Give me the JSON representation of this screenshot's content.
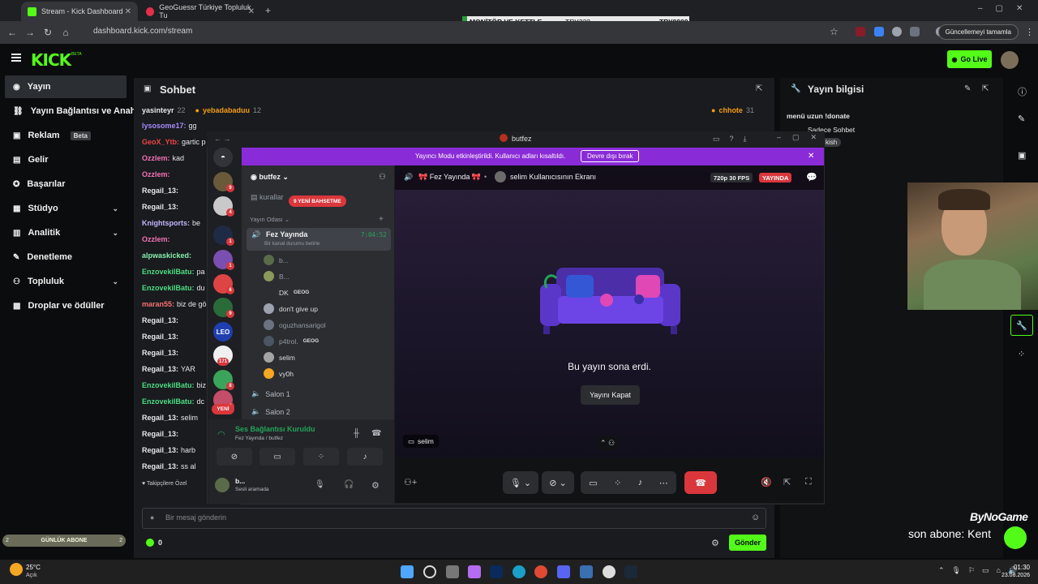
{
  "browser": {
    "tabs": [
      {
        "label": "Stream - Kick Dashboard",
        "active": true
      },
      {
        "label": "GeoGuessr Türkiye Topluluk Tu",
        "active": false
      }
    ],
    "new_tab": "+",
    "url": "dashboard.kick.com/stream",
    "update_label": "Güncellemeyi tamamla"
  },
  "ticker": {
    "item1": "MONİTÖR VE KETTLE",
    "item2": "TRY222",
    "item3": "TRY9999"
  },
  "kick": {
    "logo": "KICK",
    "logo_sup": "BETA",
    "go_live": "Go Live"
  },
  "sidebar": {
    "items": [
      {
        "label": "Yayın",
        "icon": "broadcast-icon"
      },
      {
        "label": "Yayın Bağlantısı ve Anahtarı",
        "icon": "link-icon"
      },
      {
        "label": "Reklam",
        "icon": "ad-icon",
        "badge": "Beta"
      },
      {
        "label": "Gelir",
        "icon": "revenue-icon"
      },
      {
        "label": "Başarılar",
        "icon": "trophy-icon"
      },
      {
        "label": "Stüdyo",
        "icon": "studio-icon"
      },
      {
        "label": "Analitik",
        "icon": "analytics-icon"
      },
      {
        "label": "Denetleme",
        "icon": "moderation-icon"
      },
      {
        "label": "Topluluk",
        "icon": "community-icon"
      },
      {
        "label": "Droplar ve ödüller",
        "icon": "drops-icon"
      }
    ],
    "sub_goal": "GÜNLÜK ABONE",
    "sub_left": "2",
    "sub_right": "2"
  },
  "chat": {
    "title": "Sohbet",
    "top_users": [
      {
        "name": "yasinteyr",
        "count": "22"
      },
      {
        "name": "yebadabaduu",
        "count": "12"
      },
      {
        "name": "chhote",
        "count": "31"
      }
    ],
    "lines": [
      {
        "user": "lysosome17:",
        "msg": "gg",
        "color": "#a78bfa"
      },
      {
        "user": "GeoX_Ytb:",
        "msg": "gartic p",
        "color": "#ef4444"
      },
      {
        "user": "Ozzlem:",
        "msg": "kad",
        "color": "#f472b6"
      },
      {
        "user": "Ozzlem:",
        "msg": "",
        "color": "#f472b6"
      },
      {
        "user": "Regail_13:",
        "msg": "",
        "color": "#e5e7eb"
      },
      {
        "user": "Regail_13:",
        "msg": "",
        "color": "#e5e7eb"
      },
      {
        "user": "Knightsports:",
        "msg": "be",
        "color": "#c4b5fd"
      },
      {
        "user": "Ozzlem:",
        "msg": "",
        "color": "#f472b6"
      },
      {
        "user": "alpwaskicked:",
        "msg": "",
        "color": "#86efac"
      },
      {
        "user": "EnzovekilBatu:",
        "msg": "pa",
        "color": "#4ade80"
      },
      {
        "user": "EnzovekilBatu:",
        "msg": "du",
        "color": "#4ade80"
      },
      {
        "user": "maran55:",
        "msg": "biz de gö",
        "color": "#f87171"
      },
      {
        "user": "Regail_13:",
        "msg": "",
        "color": "#e5e7eb"
      },
      {
        "user": "Regail_13:",
        "msg": "",
        "color": "#e5e7eb"
      },
      {
        "user": "Regail_13:",
        "msg": "",
        "color": "#e5e7eb"
      },
      {
        "user": "Regail_13:",
        "msg": "YAR",
        "color": "#e5e7eb"
      },
      {
        "user": "EnzovekilBatu:",
        "msg": "biz",
        "color": "#4ade80"
      },
      {
        "user": "EnzovekilBatu:",
        "msg": "dc",
        "color": "#4ade80"
      },
      {
        "user": "Regail_13:",
        "msg": "selim",
        "color": "#e5e7eb"
      },
      {
        "user": "Regail_13:",
        "msg": "",
        "color": "#e5e7eb"
      },
      {
        "user": "Regail_13:",
        "msg": "harb",
        "color": "#e5e7eb"
      },
      {
        "user": "Regail_13:",
        "msg": "ss al",
        "color": "#e5e7eb"
      }
    ],
    "followers_only": "Takipçilere Özel",
    "input_placeholder": "Bir mesaj gönderin",
    "points": "0",
    "send": "Gönder"
  },
  "discord": {
    "window_title": "butfez",
    "banner_text": "Yayıncı Modu etkinleştirildi. Kullanıcı adları kısaltıldı.",
    "banner_button": "Devre dışı bırak",
    "server_name": "butfez",
    "rules_channel": "kurallar",
    "new_mention": "9 YENİ BAHSETME",
    "category": "Yayın Odası",
    "voice_channel": "Fez Yayında",
    "voice_time": "7:04:52",
    "voice_status": "Bir kanal durumu belirle",
    "members": [
      {
        "name": "b...",
        "tag": ""
      },
      {
        "name": "B...",
        "tag": ""
      },
      {
        "name": "DK",
        "tag": "GEOG"
      },
      {
        "name": "don't give up",
        "tag": ""
      },
      {
        "name": "oguzhansarigol",
        "tag": ""
      },
      {
        "name": "p4trol.",
        "tag": "GEOG"
      },
      {
        "name": "selim",
        "tag": ""
      },
      {
        "name": "vy0h",
        "tag": ""
      }
    ],
    "salon1": "Salon 1",
    "salon2": "Salon 2",
    "new_badge": "YENİ",
    "server_badges": [
      "9",
      "4",
      "1",
      "1",
      "6",
      "9",
      "171",
      "8",
      "2"
    ],
    "leo": "LEO",
    "voice_connected": "Ses Bağlantısı Kuruldu",
    "voice_sub": "Fez Yayında",
    "voice_sub2": "/ butfez",
    "user_name": "b...",
    "user_status": "Sesli aramada",
    "stream_channel": "Fez Yayında",
    "stream_screen": "selim Kullanıcısının Ekranı",
    "quality": "720p 30 FPS",
    "live": "YAYINDA",
    "ended": "Bu yayın sona erdi.",
    "close_stream": "Yayını Kapat",
    "viewer_label": "selim"
  },
  "info": {
    "title": "Yayın bilgisi",
    "text1": "menü uzun !donate",
    "text2": "Sadece Sohbet",
    "tag": "kish"
  },
  "overlay": {
    "brand": "ByNoGame",
    "last_sub": "son abone: Kent"
  },
  "taskbar": {
    "temp": "25°C",
    "weather": "Açık",
    "time": "01:30",
    "date": "23.08.2026"
  },
  "colors": {
    "kick_green": "#53fc18",
    "discord_purple": "#5865f2",
    "banner": "#9b2fd6",
    "live_red": "#da373c"
  }
}
